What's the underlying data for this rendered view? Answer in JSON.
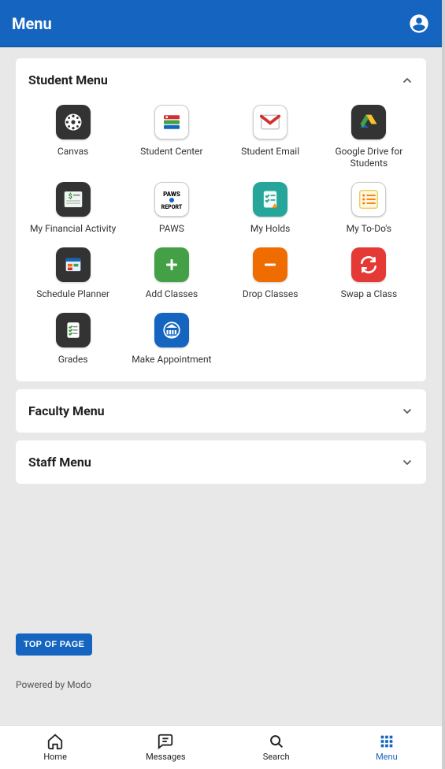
{
  "header": {
    "title": "Menu"
  },
  "sections": {
    "student": {
      "title": "Student Menu",
      "expanded": true,
      "apps": [
        {
          "label": "Canvas"
        },
        {
          "label": "Student Center"
        },
        {
          "label": "Student Email"
        },
        {
          "label": "Google Drive for Students"
        },
        {
          "label": "My Financial Activity"
        },
        {
          "label": "PAWS"
        },
        {
          "label": "My Holds"
        },
        {
          "label": "My To-Do's"
        },
        {
          "label": "Schedule Planner"
        },
        {
          "label": "Add Classes"
        },
        {
          "label": "Drop Classes"
        },
        {
          "label": "Swap a Class"
        },
        {
          "label": "Grades"
        },
        {
          "label": "Make Appointment"
        }
      ]
    },
    "faculty": {
      "title": "Faculty Menu",
      "expanded": false
    },
    "staff": {
      "title": "Staff Menu",
      "expanded": false
    }
  },
  "topOfPage": "TOP OF PAGE",
  "poweredBy": "Powered by Modo",
  "bottomNav": {
    "items": [
      {
        "label": "Home"
      },
      {
        "label": "Messages"
      },
      {
        "label": "Search"
      },
      {
        "label": "Menu"
      }
    ],
    "activeIndex": 3
  }
}
